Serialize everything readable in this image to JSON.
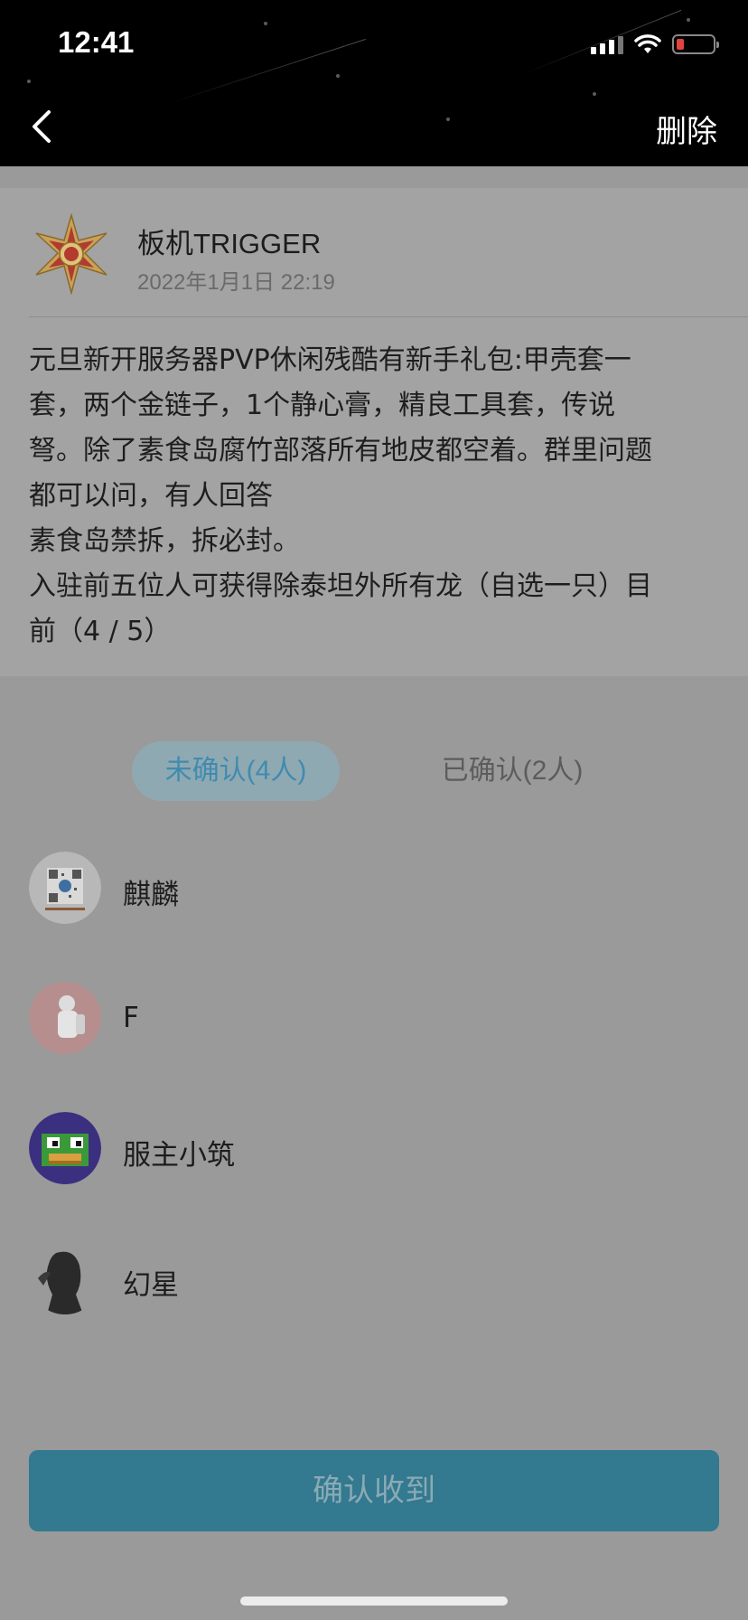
{
  "status_bar": {
    "time": "12:41"
  },
  "header": {
    "delete_label": "删除"
  },
  "post": {
    "author": "板机TRIGGER",
    "date": "2022年1月1日 22:19",
    "lines": [
      "元旦新开服务器PVP休闲残酷有新手礼包:甲壳套一",
      "套，两个金链子，1个静心膏，精良工具套，传说",
      "弩。除了素食岛腐竹部落所有地皮都空着。群里问题",
      "都可以问，有人回答",
      "素食岛禁拆，拆必封。",
      "入驻前五位人可获得除泰坦外所有龙（自选一只）目",
      "前（4 / 5）"
    ]
  },
  "tabs": {
    "unconfirmed": "未确认(4人)",
    "confirmed": "已确认(2人)"
  },
  "members": [
    {
      "name": "麒麟",
      "avatar_icon": "qr-code-avatar"
    },
    {
      "name": "F",
      "avatar_icon": "astronaut-avatar"
    },
    {
      "name": "服主小筑",
      "avatar_icon": "pixel-duck-avatar"
    },
    {
      "name": "幻星",
      "avatar_icon": "silhouette-avatar"
    }
  ],
  "confirm_button": "确认收到",
  "colors": {
    "accent_blue": "#3f8bb0",
    "button_blue": "#33798f",
    "battery_low": "#e0443e"
  }
}
